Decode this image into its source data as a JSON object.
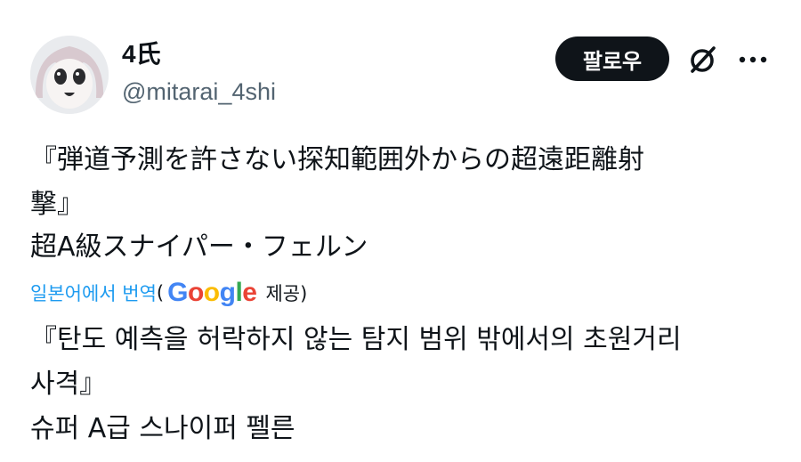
{
  "user": {
    "display_name": "4氏",
    "handle": "@mitarai_4shi"
  },
  "actions": {
    "follow_label": "팔로우"
  },
  "post": {
    "original_lines": [
      "『弾道予測を許さない探知範囲外からの超遠距離射",
      "撃』",
      "超A級スナイパー・フェルン"
    ],
    "translation_label": "일본어에서 번역",
    "translation_paren_open": "(",
    "translation_provider": "제공)",
    "translated_lines": [
      "『탄도 예측을 허락하지 않는 탐지 범위 밖에서의 초원거리",
      "사격』",
      "슈퍼 A급 스나이퍼 펠른"
    ]
  },
  "google_logo": {
    "letters": [
      "G",
      "o",
      "o",
      "g",
      "l",
      "e"
    ],
    "colors": [
      "#4285F4",
      "#EA4335",
      "#FBBC05",
      "#4285F4",
      "#34A853",
      "#EA4335"
    ]
  },
  "icons": {
    "grok": "grok-icon",
    "more": "more-icon",
    "avatar": "avatar"
  }
}
